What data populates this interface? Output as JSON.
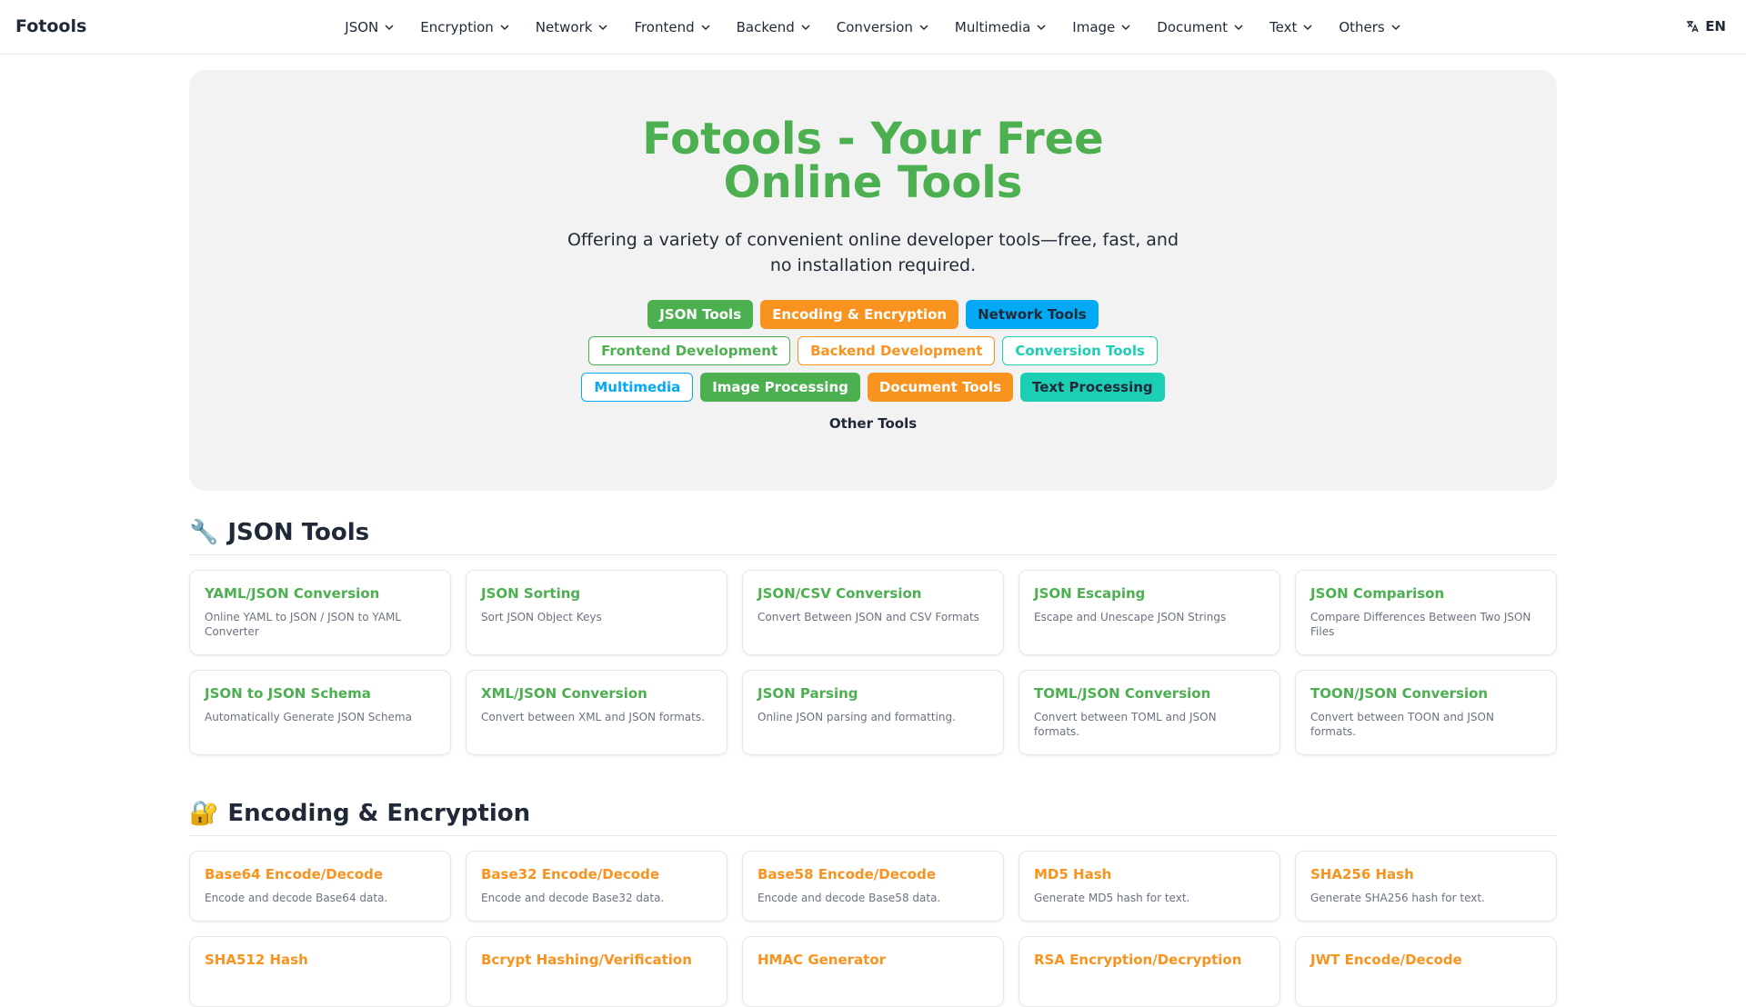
{
  "header": {
    "logo": "Fotools",
    "nav": [
      "JSON",
      "Encryption",
      "Network",
      "Frontend",
      "Backend",
      "Conversion",
      "Multimedia",
      "Image",
      "Document",
      "Text",
      "Others"
    ],
    "lang": "EN"
  },
  "hero": {
    "title": "Fotools - Your Free Online Tools",
    "description": "Offering a variety of convenient online developer tools—free, fast, and no installation required.",
    "chips": [
      "JSON Tools",
      "Encoding & Encryption",
      "Network Tools",
      "Frontend Development",
      "Backend Development",
      "Conversion Tools",
      "Multimedia",
      "Image Processing",
      "Document Tools",
      "Text Processing",
      "Other Tools"
    ]
  },
  "sections": {
    "json": {
      "emoji": "🔧",
      "title": "JSON Tools",
      "cards": [
        {
          "title": "YAML/JSON Conversion",
          "desc": "Online YAML to JSON / JSON to YAML Converter"
        },
        {
          "title": "JSON Sorting",
          "desc": "Sort JSON Object Keys"
        },
        {
          "title": "JSON/CSV Conversion",
          "desc": "Convert Between JSON and CSV Formats"
        },
        {
          "title": "JSON Escaping",
          "desc": "Escape and Unescape JSON Strings"
        },
        {
          "title": "JSON Comparison",
          "desc": "Compare Differences Between Two JSON Files"
        },
        {
          "title": "JSON to JSON Schema",
          "desc": "Automatically Generate JSON Schema"
        },
        {
          "title": "XML/JSON Conversion",
          "desc": "Convert between XML and JSON formats."
        },
        {
          "title": "JSON Parsing",
          "desc": "Online JSON parsing and formatting."
        },
        {
          "title": "TOML/JSON Conversion",
          "desc": "Convert between TOML and JSON formats."
        },
        {
          "title": "TOON/JSON Conversion",
          "desc": "Convert between TOON and JSON formats."
        }
      ]
    },
    "encryption": {
      "emoji": "🔐",
      "title": "Encoding & Encryption",
      "cards": [
        {
          "title": "Base64 Encode/Decode",
          "desc": "Encode and decode Base64 data."
        },
        {
          "title": "Base32 Encode/Decode",
          "desc": "Encode and decode Base32 data."
        },
        {
          "title": "Base58 Encode/Decode",
          "desc": "Encode and decode Base58 data."
        },
        {
          "title": "MD5 Hash",
          "desc": "Generate MD5 hash for text."
        },
        {
          "title": "SHA256 Hash",
          "desc": "Generate SHA256 hash for text."
        },
        {
          "title": "SHA512 Hash",
          "desc": ""
        },
        {
          "title": "Bcrypt Hashing/Verification",
          "desc": ""
        },
        {
          "title": "HMAC Generator",
          "desc": ""
        },
        {
          "title": "RSA Encryption/Decryption",
          "desc": ""
        },
        {
          "title": "JWT Encode/Decode",
          "desc": ""
        }
      ]
    }
  }
}
